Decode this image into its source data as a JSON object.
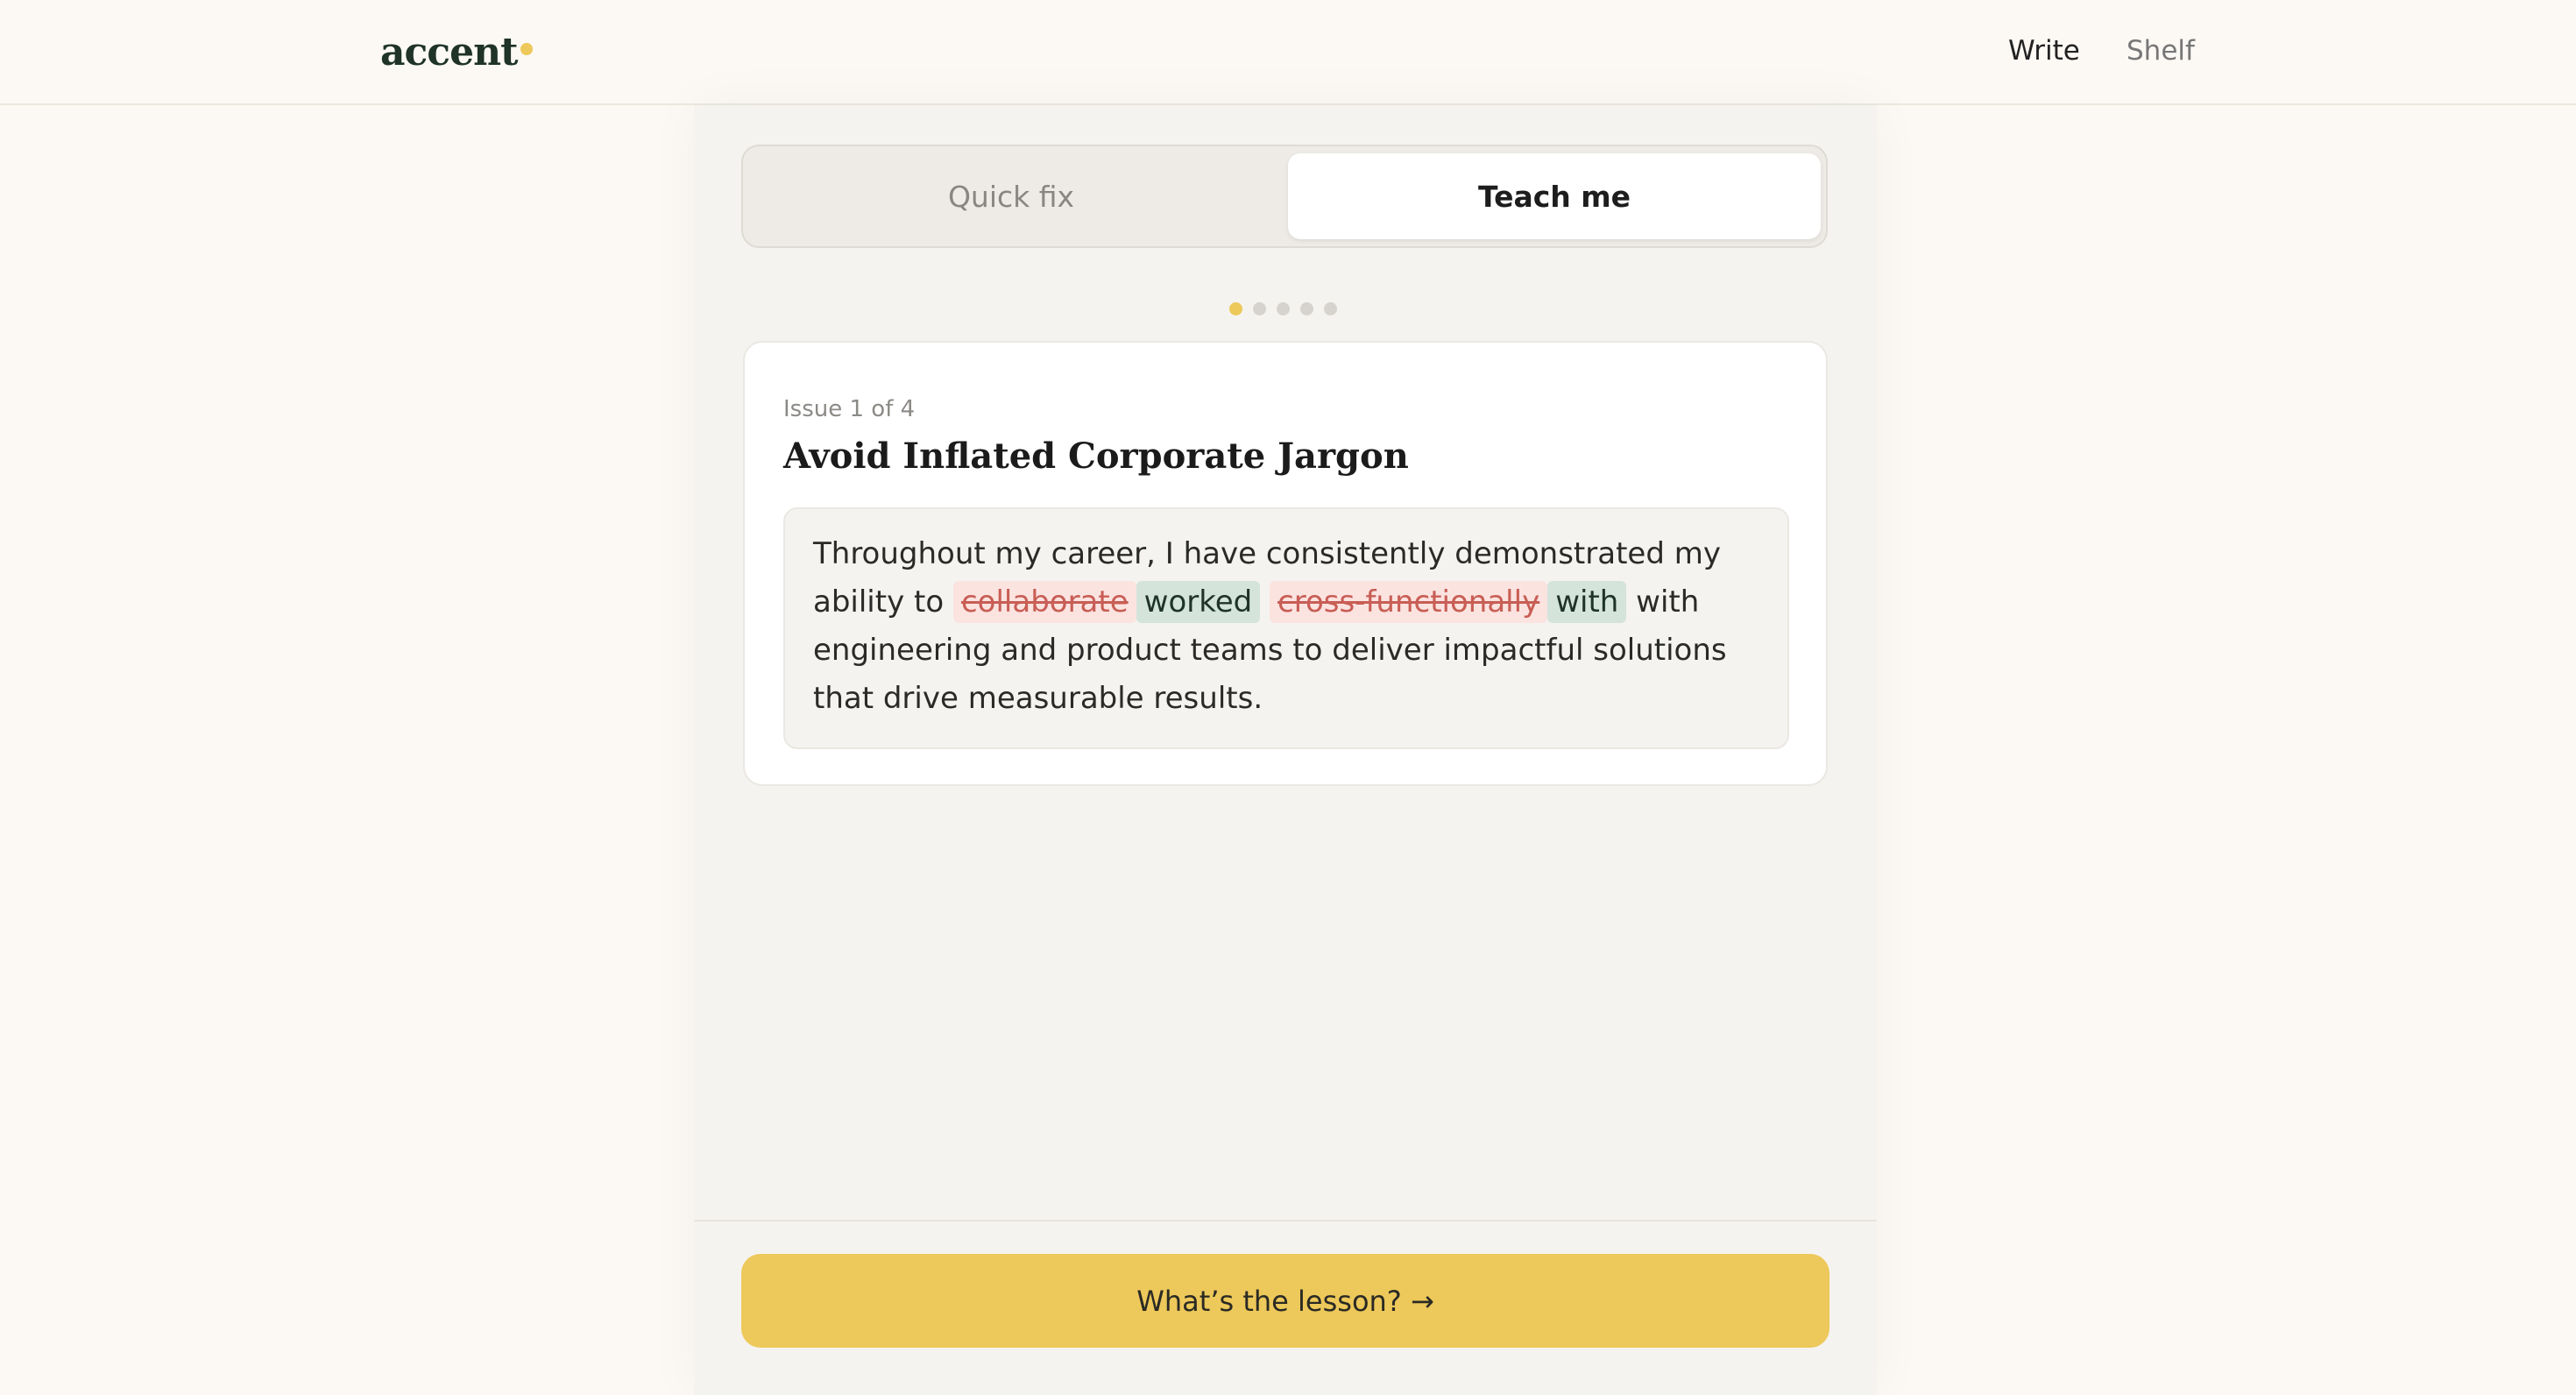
{
  "app": {
    "logo_text": "accent",
    "accent_color": "#edc85a"
  },
  "nav": {
    "write_label": "Write",
    "shelf_label": "Shelf"
  },
  "mode_toggle": {
    "quick_fix_label": "Quick fix",
    "teach_me_label": "Teach me",
    "active": "Teach me"
  },
  "progress": {
    "total_steps": 5,
    "current_step": 1,
    "active_color": "#edc85a",
    "inactive_color": "#d6d3ce"
  },
  "issue": {
    "counter": "Issue 1 of 4",
    "title": "Avoid Inflated Corporate Jargon",
    "passage": {
      "intro": "Throughout my career, I have consistently demonstrated my ability to",
      "removed_1": "collaborate",
      "added_1": "worked",
      "removed_2": "cross-functionally",
      "added_2": "with",
      "outro": "with engineering and product teams to deliver impactful solutions that drive measurable results."
    }
  },
  "footer": {
    "cta_label": "What’s the lesson? →"
  }
}
